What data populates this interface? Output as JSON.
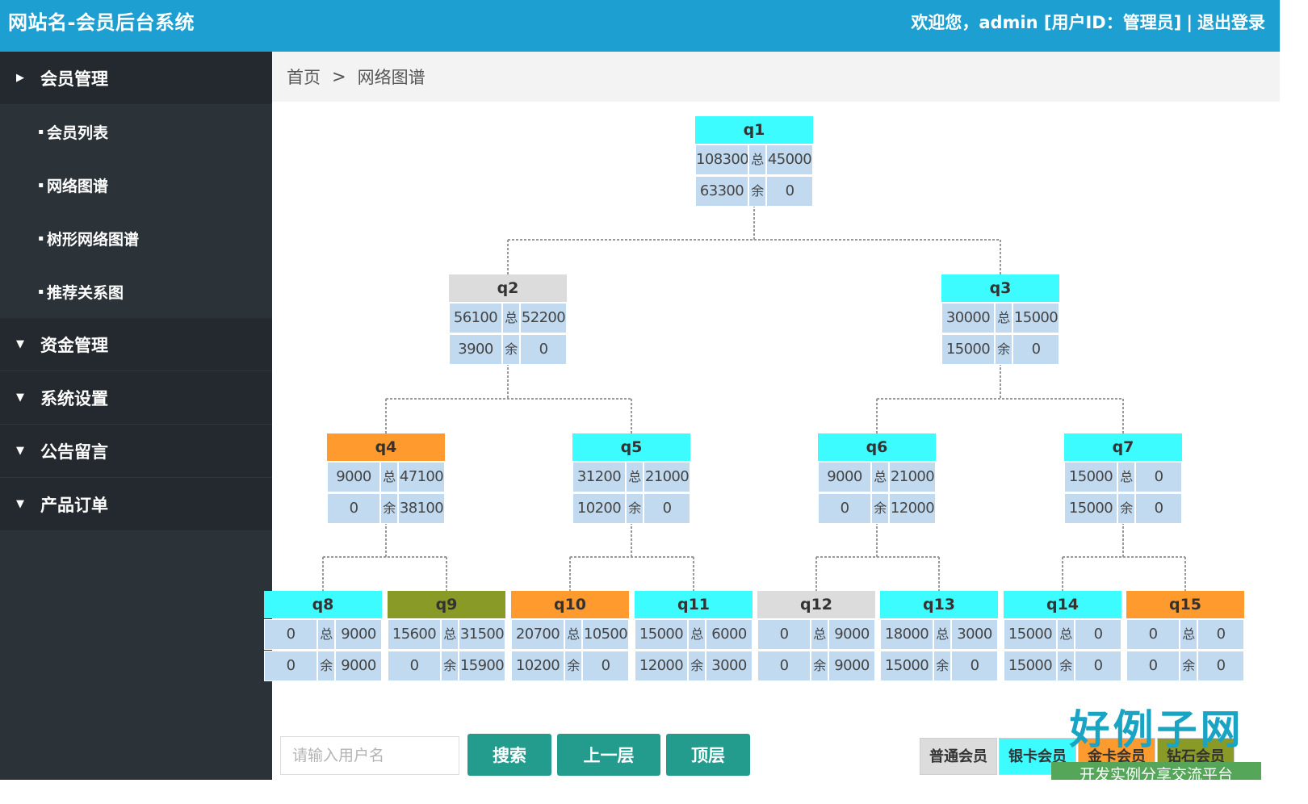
{
  "header": {
    "site_title": "网站名-会员后台系统",
    "welcome": "欢迎您，admin [用户ID：管理员]",
    "separator": "|",
    "logout": "退出登录"
  },
  "sidebar": {
    "groups": [
      {
        "label": "会员管理",
        "expanded": true,
        "items": [
          "会员列表",
          "网络图谱",
          "树形网络图谱",
          "推荐关系图"
        ]
      },
      {
        "label": "资金管理",
        "expanded": false
      },
      {
        "label": "系统设置",
        "expanded": false
      },
      {
        "label": "公告留言",
        "expanded": false
      },
      {
        "label": "产品订单",
        "expanded": false
      }
    ]
  },
  "breadcrumb": {
    "home": "首页",
    "sep": ">",
    "current": "网络图谱"
  },
  "cell_labels": {
    "total": "总",
    "remain": "余"
  },
  "colors": {
    "ordinary": "#dcdcdc",
    "silver": "#3cfcff",
    "gold": "#fe9a2e",
    "diamond": "#8a9a26",
    "cell_bg": "#c2daf0",
    "sidebar_bg": "#2b3338",
    "header_bg": "#1e9fd1",
    "button_bg": "#239c8e"
  },
  "tree": [
    {
      "id": "q1",
      "level": "silver",
      "r1": [
        "108300",
        "45000"
      ],
      "r2": [
        "63300",
        "0"
      ]
    },
    {
      "id": "q2",
      "level": "ordinary",
      "r1": [
        "56100",
        "52200"
      ],
      "r2": [
        "3900",
        "0"
      ]
    },
    {
      "id": "q3",
      "level": "silver",
      "r1": [
        "30000",
        "15000"
      ],
      "r2": [
        "15000",
        "0"
      ]
    },
    {
      "id": "q4",
      "level": "gold",
      "r1": [
        "9000",
        "47100"
      ],
      "r2": [
        "0",
        "38100"
      ]
    },
    {
      "id": "q5",
      "level": "silver",
      "r1": [
        "31200",
        "21000"
      ],
      "r2": [
        "10200",
        "0"
      ]
    },
    {
      "id": "q6",
      "level": "silver",
      "r1": [
        "9000",
        "21000"
      ],
      "r2": [
        "0",
        "12000"
      ]
    },
    {
      "id": "q7",
      "level": "silver",
      "r1": [
        "15000",
        "0"
      ],
      "r2": [
        "15000",
        "0"
      ]
    },
    {
      "id": "q8",
      "level": "silver",
      "r1": [
        "0",
        "9000"
      ],
      "r2": [
        "0",
        "9000"
      ]
    },
    {
      "id": "q9",
      "level": "diamond",
      "r1": [
        "15600",
        "31500"
      ],
      "r2": [
        "0",
        "15900"
      ]
    },
    {
      "id": "q10",
      "level": "gold",
      "r1": [
        "20700",
        "10500"
      ],
      "r2": [
        "10200",
        "0"
      ]
    },
    {
      "id": "q11",
      "level": "silver",
      "r1": [
        "15000",
        "6000"
      ],
      "r2": [
        "12000",
        "3000"
      ]
    },
    {
      "id": "q12",
      "level": "ordinary",
      "r1": [
        "0",
        "9000"
      ],
      "r2": [
        "0",
        "9000"
      ]
    },
    {
      "id": "q13",
      "level": "silver",
      "r1": [
        "18000",
        "3000"
      ],
      "r2": [
        "15000",
        "0"
      ]
    },
    {
      "id": "q14",
      "level": "silver",
      "r1": [
        "15000",
        "0"
      ],
      "r2": [
        "15000",
        "0"
      ]
    },
    {
      "id": "q15",
      "level": "gold",
      "r1": [
        "0",
        "0"
      ],
      "r2": [
        "0",
        "0"
      ]
    }
  ],
  "search": {
    "placeholder": "请输入用户名"
  },
  "buttons": {
    "search": "搜索",
    "up": "上一层",
    "top": "顶层"
  },
  "legend": [
    {
      "key": "ordinary",
      "label": "普通会员"
    },
    {
      "key": "silver",
      "label": "银卡会员"
    },
    {
      "key": "gold",
      "label": "金卡会员"
    },
    {
      "key": "diamond",
      "label": "钻石会员"
    }
  ],
  "watermark": {
    "logo": "好例子网",
    "tagline": "开发实例分享交流平台"
  }
}
